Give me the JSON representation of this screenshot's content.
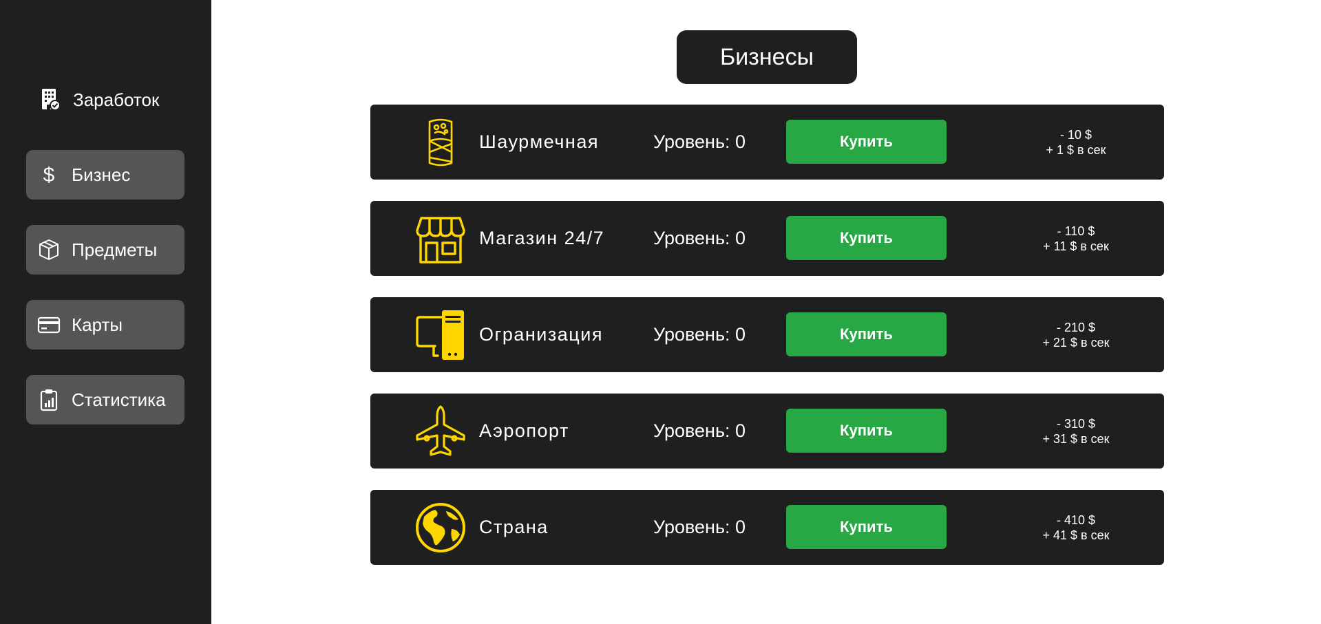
{
  "sidebar": {
    "items": [
      {
        "label": "Заработок",
        "icon": "building-check-icon"
      },
      {
        "label": "Бизнес",
        "icon": "dollar-icon"
      },
      {
        "label": "Предметы",
        "icon": "box-icon"
      },
      {
        "label": "Карты",
        "icon": "credit-card-icon"
      },
      {
        "label": "Статистика",
        "icon": "clipboard-chart-icon"
      }
    ]
  },
  "page": {
    "title": "Бизнесы"
  },
  "businesses": [
    {
      "name": "Шаурмечная",
      "level": "Уровень: 0",
      "buy_label": "Купить",
      "cost": "- 10 $",
      "income": "+ 1 $ в сек",
      "icon": "shawarma-icon"
    },
    {
      "name": "Магазин 24/7",
      "level": "Уровень: 0",
      "buy_label": "Купить",
      "cost": "- 110 $",
      "income": "+ 11 $ в сек",
      "icon": "store-icon"
    },
    {
      "name": "Огранизация",
      "level": "Уровень: 0",
      "buy_label": "Купить",
      "cost": "- 210 $",
      "income": "+ 21 $ в сек",
      "icon": "computer-icon"
    },
    {
      "name": "Аэропорт",
      "level": "Уровень: 0",
      "buy_label": "Купить",
      "cost": "- 310 $",
      "income": "+ 31 $ в сек",
      "icon": "airplane-icon"
    },
    {
      "name": "Страна",
      "level": "Уровень: 0",
      "buy_label": "Купить",
      "cost": "- 410 $",
      "income": "+ 41 $ в сек",
      "icon": "globe-icon"
    }
  ],
  "colors": {
    "sidebar_bg": "#1f1f1f",
    "nav_item_bg": "#555555",
    "row_bg": "#1f1f1f",
    "buy_button": "#28a745",
    "icon_accent": "#ffd700"
  }
}
